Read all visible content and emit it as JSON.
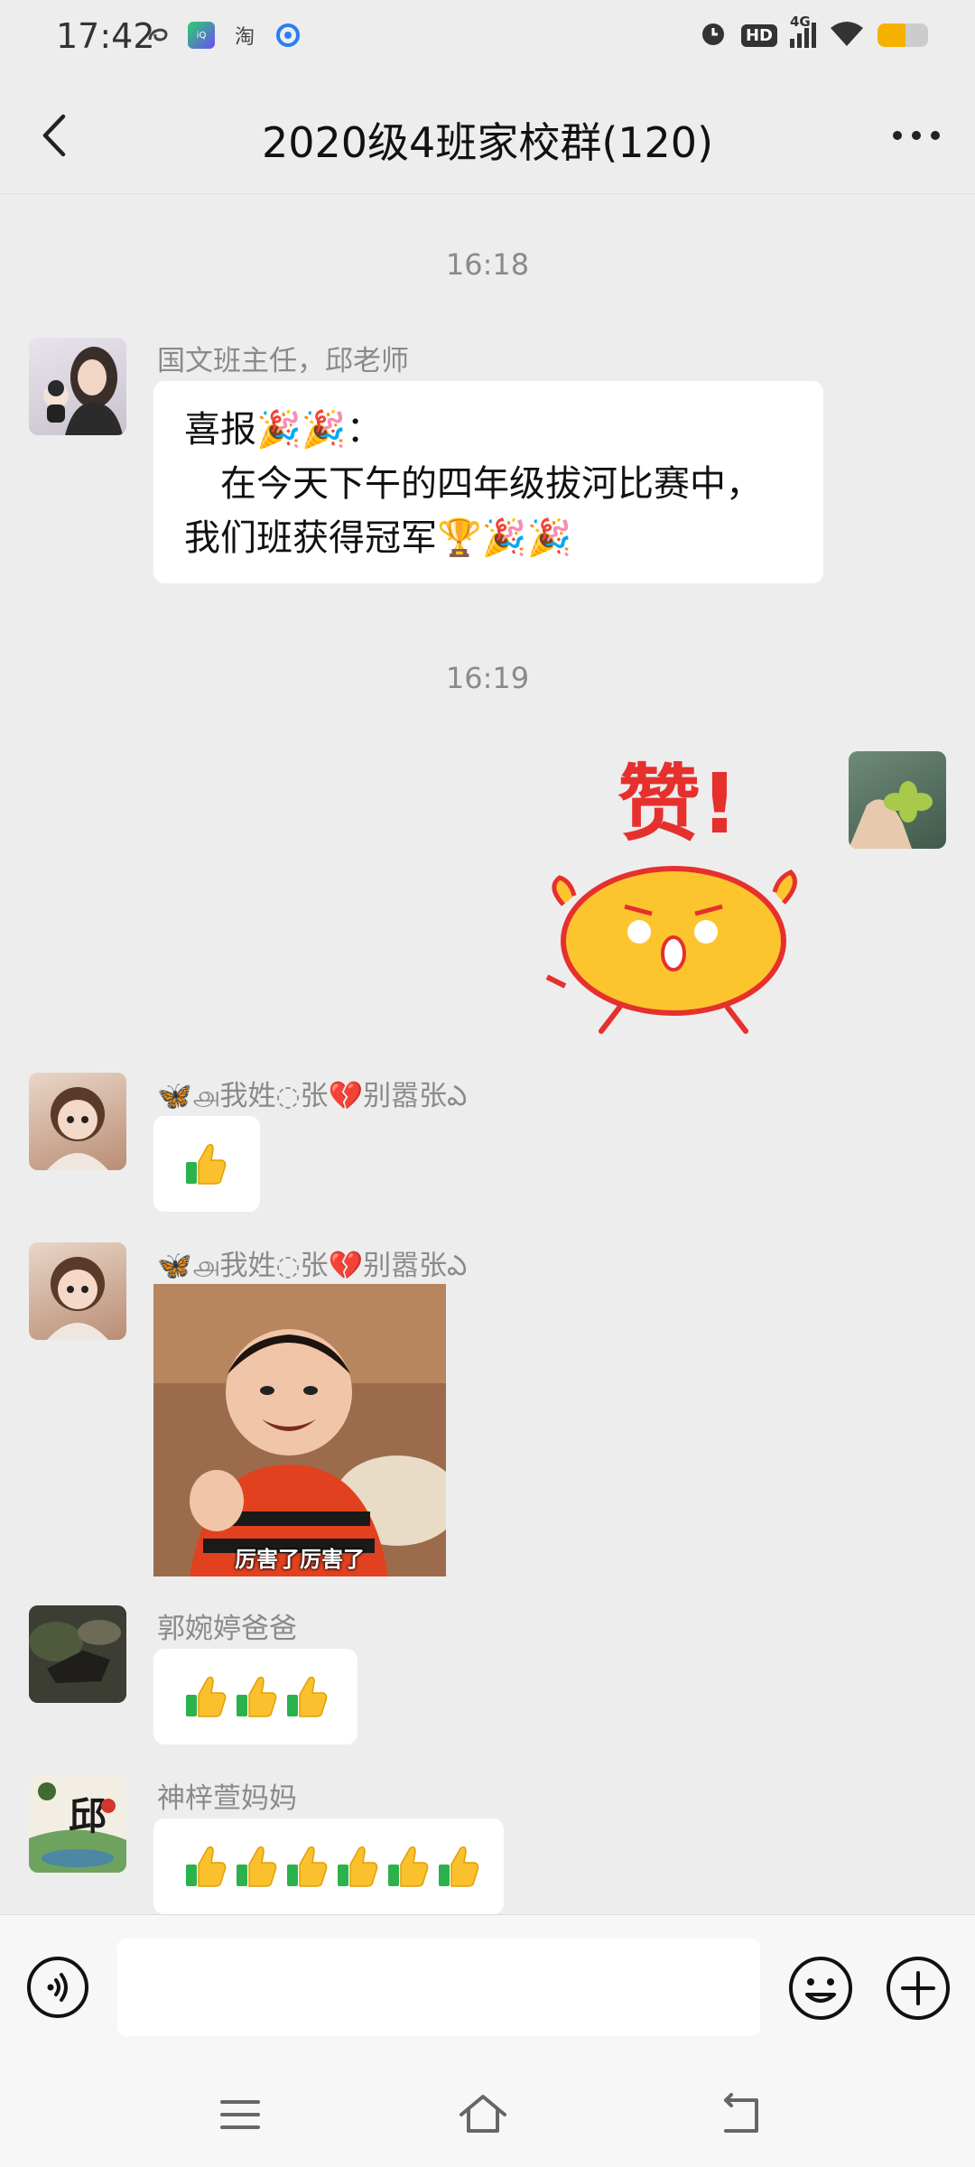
{
  "status_bar": {
    "time": "17:42",
    "left_icons": [
      "swirl-icon",
      "app-icon-iqiyi",
      "taobao-icon",
      "browser-icon"
    ],
    "taobao_text": "淘",
    "network": "4G",
    "hd": "HD",
    "battery_level": 0.55,
    "battery_color": "#f6b100"
  },
  "header": {
    "title": "2020级4班家校群(120)"
  },
  "timestamps": [
    "16:18",
    "16:19"
  ],
  "messages": [
    {
      "sender": "国文班主任，邱老师",
      "lines": [
        "喜报🎉🎉：",
        "　在今天下午的四年级拔河比赛中，",
        "我们班获得冠军🏆🎉🎉"
      ]
    },
    {
      "self": true,
      "sticker_text": "赞!"
    },
    {
      "sender": "🦋௮我姓◌张💔别嚣张ఎ",
      "thumbs": 1
    },
    {
      "sender": "🦋௮我姓◌张💔别嚣张ఎ",
      "image_caption": "厉害了厉害了"
    },
    {
      "sender": "郭婉婷爸爸",
      "thumbs": 3
    },
    {
      "sender": "神梓萱妈妈",
      "thumbs": 6
    }
  ],
  "input": {
    "value": "",
    "placeholder": ""
  },
  "colors": {
    "background": "#ededed",
    "bubble": "#ffffff",
    "sticker_yellow": "#fcc52d",
    "sticker_red": "#e6302e"
  }
}
